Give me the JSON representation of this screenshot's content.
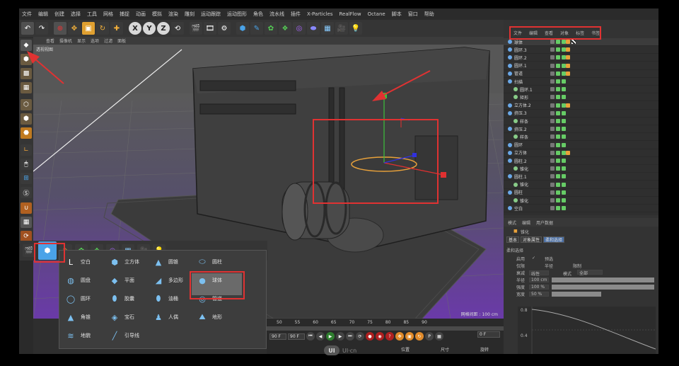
{
  "menubar": {
    "items": [
      "文件",
      "编辑",
      "创建",
      "选择",
      "工具",
      "网格",
      "捕捉",
      "动画",
      "模拟",
      "渲染",
      "雕刻",
      "运动跟踪",
      "运动图形",
      "角色",
      "流水线",
      "插件",
      "X-Particles",
      "RealFlow",
      "Octane",
      "脚本",
      "窗口",
      "帮助"
    ]
  },
  "toolbar": {
    "undo_icon": "undo-icon",
    "axes": [
      "X",
      "Y",
      "Z"
    ]
  },
  "viewport": {
    "menu": [
      "查看",
      "摄像机",
      "显示",
      "选项",
      "过滤",
      "面板"
    ],
    "label": "透视视图",
    "grid_info": "网格间距 : 100 cm"
  },
  "object_manager": {
    "tabs": [
      "文件",
      "编辑",
      "查看",
      "对象",
      "标签",
      "书签"
    ],
    "objects": [
      {
        "name": "球体",
        "indent": 0
      },
      {
        "name": "圆环.3",
        "indent": 0
      },
      {
        "name": "圆环.2",
        "indent": 0
      },
      {
        "name": "圆环.1",
        "indent": 0
      },
      {
        "name": "管道",
        "indent": 0
      },
      {
        "name": "扫描",
        "indent": 0
      },
      {
        "name": "圆环.1",
        "indent": 1
      },
      {
        "name": "矩形",
        "indent": 1
      },
      {
        "name": "立方体.2",
        "indent": 0
      },
      {
        "name": "挤压.3",
        "indent": 0
      },
      {
        "name": "样条",
        "indent": 1
      },
      {
        "name": "挤压.2",
        "indent": 0
      },
      {
        "name": "样条",
        "indent": 1
      },
      {
        "name": "圆环",
        "indent": 0
      },
      {
        "name": "立方体",
        "indent": 0
      },
      {
        "name": "圆柱.2",
        "indent": 0
      },
      {
        "name": "锥化",
        "indent": 1
      },
      {
        "name": "圆柱.1",
        "indent": 0
      },
      {
        "name": "锥化",
        "indent": 1
      },
      {
        "name": "圆柱",
        "indent": 0
      },
      {
        "name": "锥化",
        "indent": 1
      },
      {
        "name": "空白",
        "indent": 0
      }
    ]
  },
  "attributes": {
    "tabs": [
      "模式",
      "编辑",
      "用户数据"
    ],
    "object_title": "锥化",
    "subtabs": [
      "基本",
      "对象属性",
      "柔和选择"
    ],
    "section": "柔和选择",
    "rows": [
      {
        "label": "启用",
        "value": "✓"
      },
      {
        "label": "仅限",
        "value": ""
      },
      {
        "label": "衰减",
        "value": "线性"
      },
      {
        "label": "半径",
        "value": "100 cm"
      },
      {
        "label": "强度",
        "value": "100 %"
      },
      {
        "label": "宽度",
        "value": "50 %"
      }
    ],
    "extra_labels": [
      "预选",
      "半径",
      "限制",
      "模式",
      "全部"
    ],
    "curve_ticks": [
      "0.8",
      "0.4",
      "0"
    ]
  },
  "timeline": {
    "ticks": [
      "50",
      "55",
      "60",
      "65",
      "70",
      "75",
      "80",
      "85",
      "90"
    ],
    "current_frame": "0 F",
    "end_frame": "90 F",
    "end_frame2": "90 F",
    "coords": [
      "位置",
      "尺寸",
      "旋转"
    ]
  },
  "popup": {
    "items": [
      {
        "label": "空白",
        "icon": "null-icon",
        "col": 0,
        "row": 0
      },
      {
        "label": "圆盘",
        "icon": "disc-icon",
        "col": 0,
        "row": 1
      },
      {
        "label": "圆环",
        "icon": "torus-icon",
        "col": 0,
        "row": 2
      },
      {
        "label": "角锥",
        "icon": "pyramid-icon",
        "col": 0,
        "row": 3
      },
      {
        "label": "地貌",
        "icon": "landscape-icon",
        "col": 0,
        "row": 4
      },
      {
        "label": "立方体",
        "icon": "cube-icon",
        "col": 1,
        "row": 0
      },
      {
        "label": "平面",
        "icon": "plane-icon",
        "col": 1,
        "row": 1
      },
      {
        "label": "胶囊",
        "icon": "capsule-icon",
        "col": 1,
        "row": 2
      },
      {
        "label": "宝石",
        "icon": "gem-icon",
        "col": 1,
        "row": 3
      },
      {
        "label": "引导线",
        "icon": "guide-icon",
        "col": 1,
        "row": 4
      },
      {
        "label": "圆锥",
        "icon": "cone-icon",
        "col": 2,
        "row": 0
      },
      {
        "label": "多边形",
        "icon": "polygon-icon",
        "col": 2,
        "row": 1
      },
      {
        "label": "油桶",
        "icon": "oil-tank-icon",
        "col": 2,
        "row": 2
      },
      {
        "label": "人偶",
        "icon": "figure-icon",
        "col": 2,
        "row": 3
      },
      {
        "label": "圆柱",
        "icon": "cylinder-icon",
        "col": 3,
        "row": 0
      },
      {
        "label": "球体",
        "icon": "sphere-icon",
        "col": 3,
        "row": 1
      },
      {
        "label": "管道",
        "icon": "tube-icon",
        "col": 3,
        "row": 2
      },
      {
        "label": "地形",
        "icon": "terrain-icon",
        "col": 3,
        "row": 3
      }
    ]
  },
  "watermark": {
    "text": "UI·cn"
  }
}
